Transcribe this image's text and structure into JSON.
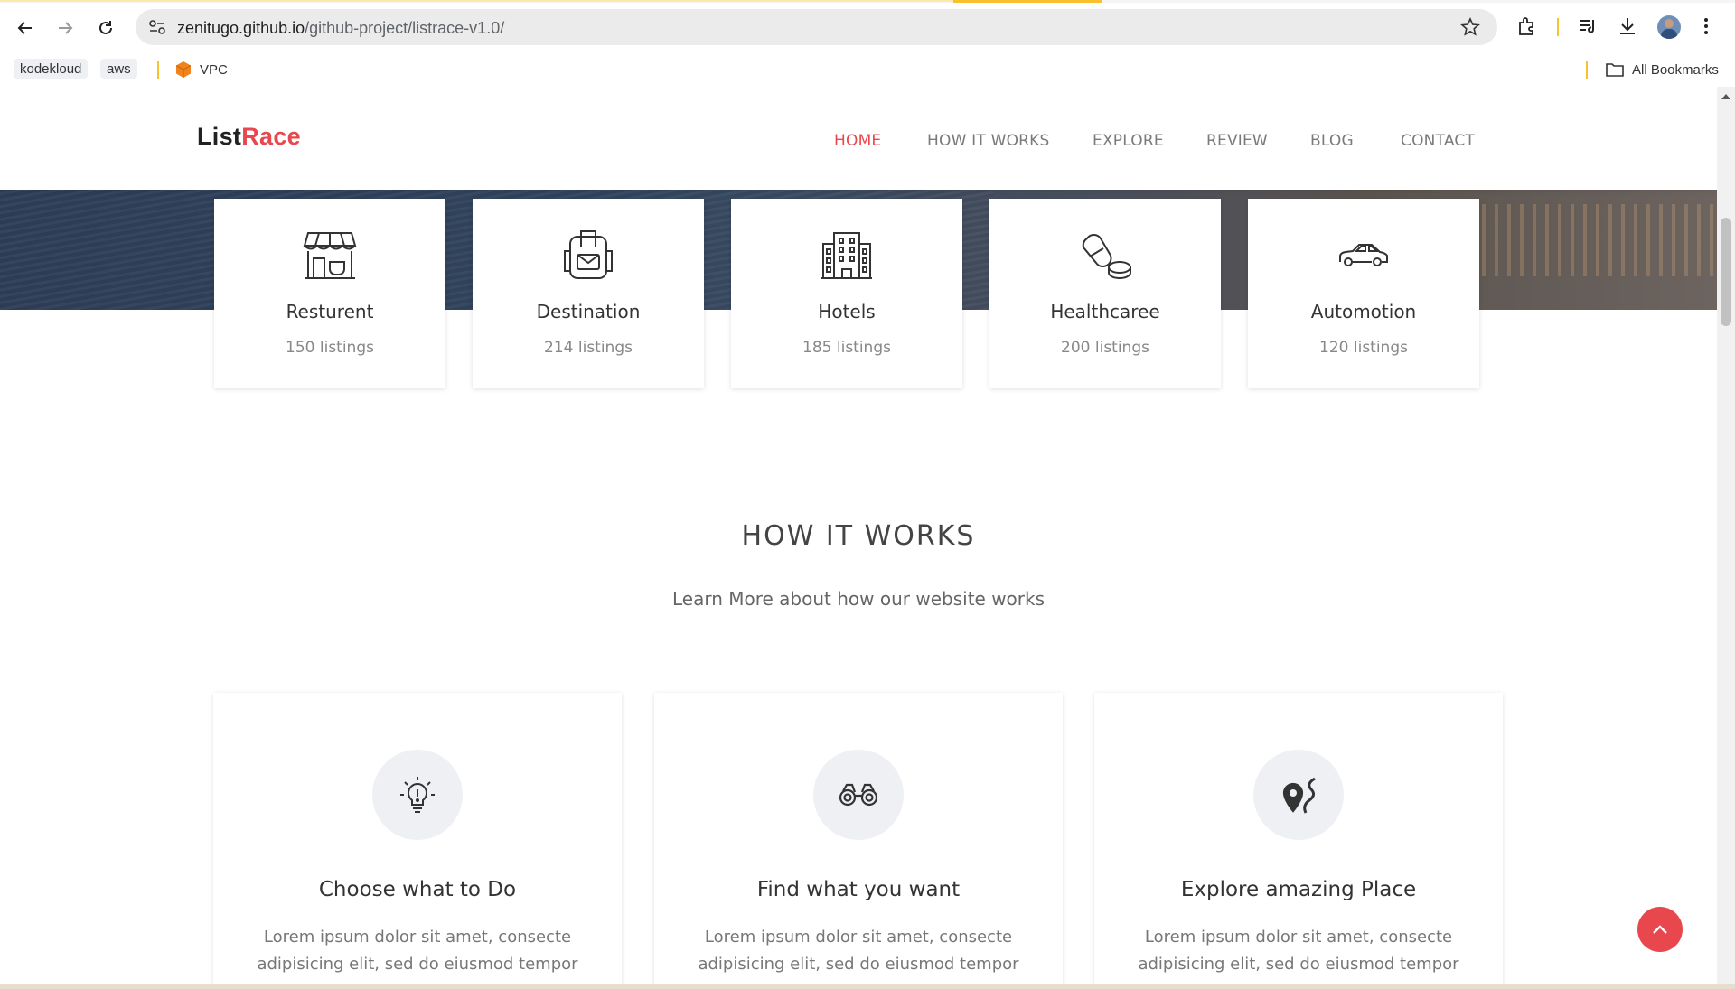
{
  "browser": {
    "url_host": "zenitugo.github.io",
    "url_path": "/github-project/listrace-v1.0/",
    "bookmarks": [
      "kodekloud",
      "aws",
      "VPC"
    ],
    "all_bookmarks_label": "All Bookmarks"
  },
  "header": {
    "logo_part1": "List",
    "logo_part2": "Race",
    "nav": [
      "HOME",
      "HOW IT WORKS",
      "EXPLORE",
      "REVIEW",
      "BLOG",
      "CONTACT"
    ],
    "active_nav": "HOME"
  },
  "categories": [
    {
      "name": "Resturent",
      "count": "150 listings",
      "icon": "store-icon"
    },
    {
      "name": "Destination",
      "count": "214 listings",
      "icon": "backpack-icon"
    },
    {
      "name": "Hotels",
      "count": "185 listings",
      "icon": "building-icon"
    },
    {
      "name": "Healthcaree",
      "count": "200 listings",
      "icon": "pill-icon"
    },
    {
      "name": "Automotion",
      "count": "120 listings",
      "icon": "car-icon"
    }
  ],
  "how_it_works": {
    "title": "HOW IT WORKS",
    "subtitle": "Learn More about how our website works",
    "steps": [
      {
        "title": "Choose what to Do",
        "text": "Lorem ipsum dolor sit amet, consecte adipisicing elit, sed do eiusmod tempor",
        "icon": "lightbulb-icon"
      },
      {
        "title": "Find what you want",
        "text": "Lorem ipsum dolor sit amet, consecte adipisicing elit, sed do eiusmod tempor",
        "icon": "binoculars-icon"
      },
      {
        "title": "Explore amazing Place",
        "text": "Lorem ipsum dolor sit amet, consecte adipisicing elit, sed do eiusmod tempor",
        "icon": "map-pin-icon"
      }
    ]
  },
  "colors": {
    "accent": "#e8474e",
    "text": "#333333",
    "muted": "#888888"
  }
}
